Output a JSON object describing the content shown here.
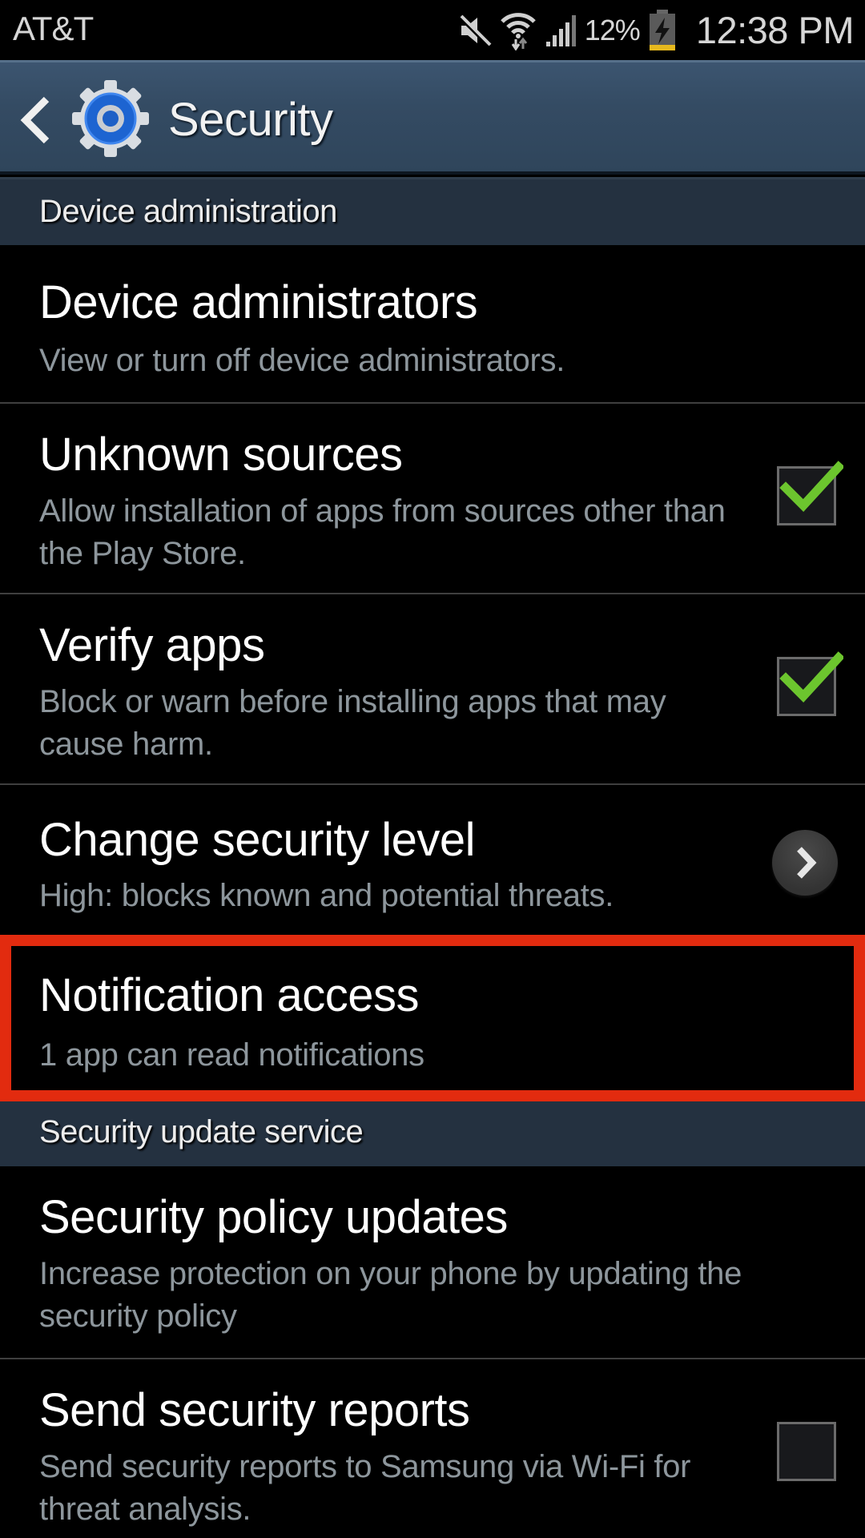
{
  "status_bar": {
    "carrier": "AT&T",
    "icons": [
      "mute-icon",
      "wifi-icon",
      "signal-icon",
      "battery-charging-icon"
    ],
    "battery_percent": "12%",
    "time": "12:38 PM"
  },
  "action_bar": {
    "back_icon": "chevron-left-icon",
    "app_icon": "settings-gear-icon",
    "title": "Security"
  },
  "sections": [
    {
      "header": "Device administration",
      "items": [
        {
          "title": "Device administrators",
          "summary": "View or turn off device administrators.",
          "control": "none"
        },
        {
          "title": "Unknown sources",
          "summary": "Allow installation of apps from sources other than the Play Store.",
          "control": "checkbox",
          "checked": true
        },
        {
          "title": "Verify apps",
          "summary": "Block or warn before installing apps that may cause harm.",
          "control": "checkbox",
          "checked": true
        },
        {
          "title": "Change security level",
          "summary": "High: blocks known and potential threats.",
          "control": "chevron"
        },
        {
          "title": "Notification access",
          "summary": "1 app can read notifications",
          "control": "none",
          "highlighted": true
        }
      ]
    },
    {
      "header": "Security update service",
      "items": [
        {
          "title": "Security policy updates",
          "summary": "Increase protection on your phone by updating the security policy",
          "control": "none"
        },
        {
          "title": "Send security reports",
          "summary": "Send security reports to Samsung via Wi-Fi for threat analysis.",
          "control": "checkbox",
          "checked": false
        }
      ]
    }
  ],
  "colors": {
    "action_bar": "#344b63",
    "section_header": "#243140",
    "checkmark": "#6cc52e",
    "highlight_border": "#e22b0f",
    "summary_text": "#8d969c"
  }
}
